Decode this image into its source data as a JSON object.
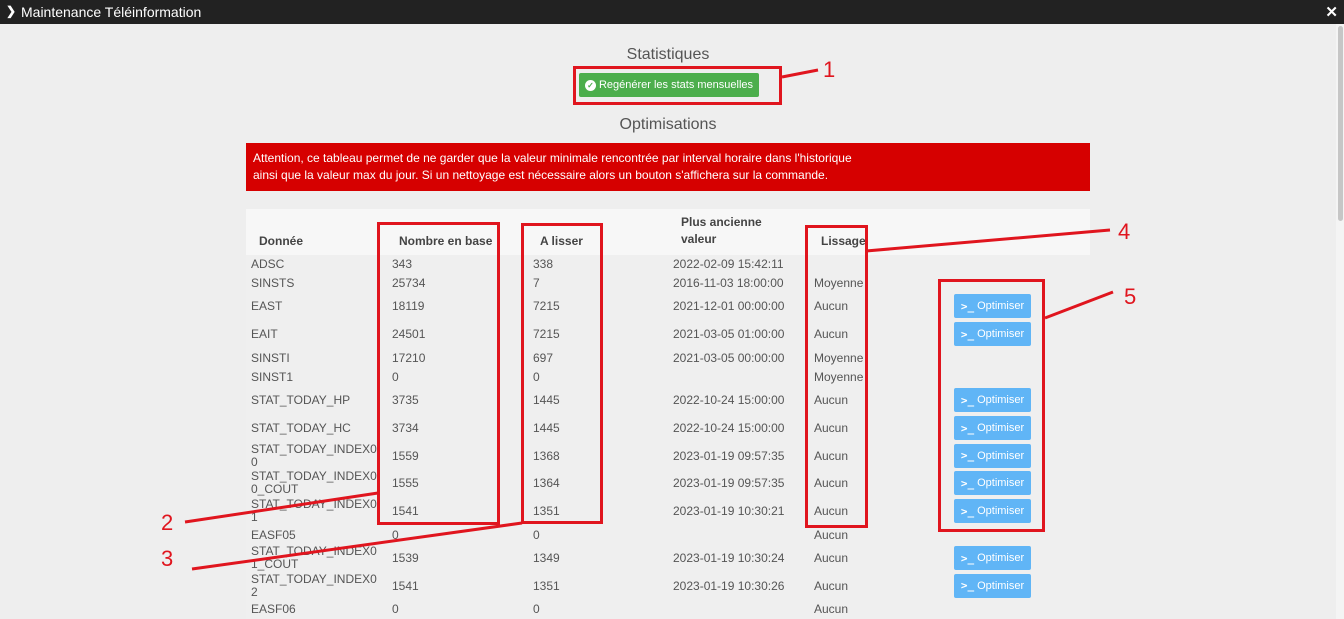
{
  "window": {
    "title": "Maintenance Téléinformation",
    "close_glyph": "✕"
  },
  "stats": {
    "heading": "Statistiques",
    "regen_label": "Regénérer les stats mensuelles"
  },
  "optim": {
    "heading": "Optimisations",
    "alert_line1": "Attention, ce tableau permet de ne garder que la valeur minimale rencontrée par interval horaire dans l'historique",
    "alert_line2": "ainsi que la valeur max du jour. Si un nettoyage est nécessaire alors un bouton s'affichera sur la commande."
  },
  "table": {
    "headers": {
      "donnee": "Donnée",
      "nombre": "Nombre en base",
      "lisser": "A lisser",
      "ancienne_1": "Plus ancienne",
      "ancienne_2": "valeur",
      "lissage": "Lissage"
    },
    "optimize_label": "Optimiser",
    "rows": [
      {
        "name": "ADSC",
        "count": "343",
        "smooth": "338",
        "oldest": "2022-02-09 15:42:11",
        "lissage": "",
        "action": false
      },
      {
        "name": "SINSTS",
        "count": "25734",
        "smooth": "7",
        "oldest": "2016-11-03 18:00:00",
        "lissage": "Moyenne",
        "action": false
      },
      {
        "name": "EAST",
        "count": "18119",
        "smooth": "7215",
        "oldest": "2021-12-01 00:00:00",
        "lissage": "Aucun",
        "action": true
      },
      {
        "name": "EAIT",
        "count": "24501",
        "smooth": "7215",
        "oldest": "2021-03-05 01:00:00",
        "lissage": "Aucun",
        "action": true
      },
      {
        "name": "SINSTI",
        "count": "17210",
        "smooth": "697",
        "oldest": "2021-03-05 00:00:00",
        "lissage": "Moyenne",
        "action": false
      },
      {
        "name": "SINST1",
        "count": "0",
        "smooth": "0",
        "oldest": "",
        "lissage": "Moyenne",
        "action": false
      },
      {
        "name": "STAT_TODAY_HP",
        "count": "3735",
        "smooth": "1445",
        "oldest": "2022-10-24 15:00:00",
        "lissage": "Aucun",
        "action": true
      },
      {
        "name": "STAT_TODAY_HC",
        "count": "3734",
        "smooth": "1445",
        "oldest": "2022-10-24 15:00:00",
        "lissage": "Aucun",
        "action": true
      },
      {
        "name": "STAT_TODAY_INDEX00",
        "name_a": "STAT_TODAY_INDEX0",
        "name_b": "0",
        "count": "1559",
        "smooth": "1368",
        "oldest": "2023-01-19 09:57:35",
        "lissage": "Aucun",
        "action": true
      },
      {
        "name": "STAT_TODAY_INDEX00_COUT",
        "name_a": "STAT_TODAY_INDEX0",
        "name_b": "0_COUT",
        "count": "1555",
        "smooth": "1364",
        "oldest": "2023-01-19 09:57:35",
        "lissage": "Aucun",
        "action": true
      },
      {
        "name": "STAT_TODAY_INDEX01",
        "name_a": "STAT_TODAY_INDEX0",
        "name_b": "1",
        "count": "1541",
        "smooth": "1351",
        "oldest": "2023-01-19 10:30:21",
        "lissage": "Aucun",
        "action": true
      },
      {
        "name": "EASF05",
        "count": "0",
        "smooth": "0",
        "oldest": "",
        "lissage": "Aucun",
        "action": false
      },
      {
        "name": "STAT_TODAY_INDEX01_COUT",
        "name_a": "STAT_TODAY_INDEX0",
        "name_b": "1_COUT",
        "count": "1539",
        "smooth": "1349",
        "oldest": "2023-01-19 10:30:24",
        "lissage": "Aucun",
        "action": true
      },
      {
        "name": "STAT_TODAY_INDEX02",
        "name_a": "STAT_TODAY_INDEX0",
        "name_b": "2",
        "count": "1541",
        "smooth": "1351",
        "oldest": "2023-01-19 10:30:26",
        "lissage": "Aucun",
        "action": true
      },
      {
        "name": "EASF06",
        "count": "0",
        "smooth": "0",
        "oldest": "",
        "lissage": "Aucun",
        "action": false
      }
    ]
  },
  "annotations": {
    "n1": "1",
    "n2": "2",
    "n3": "3",
    "n4": "4",
    "n5": "5",
    "color": "#e0151e"
  }
}
